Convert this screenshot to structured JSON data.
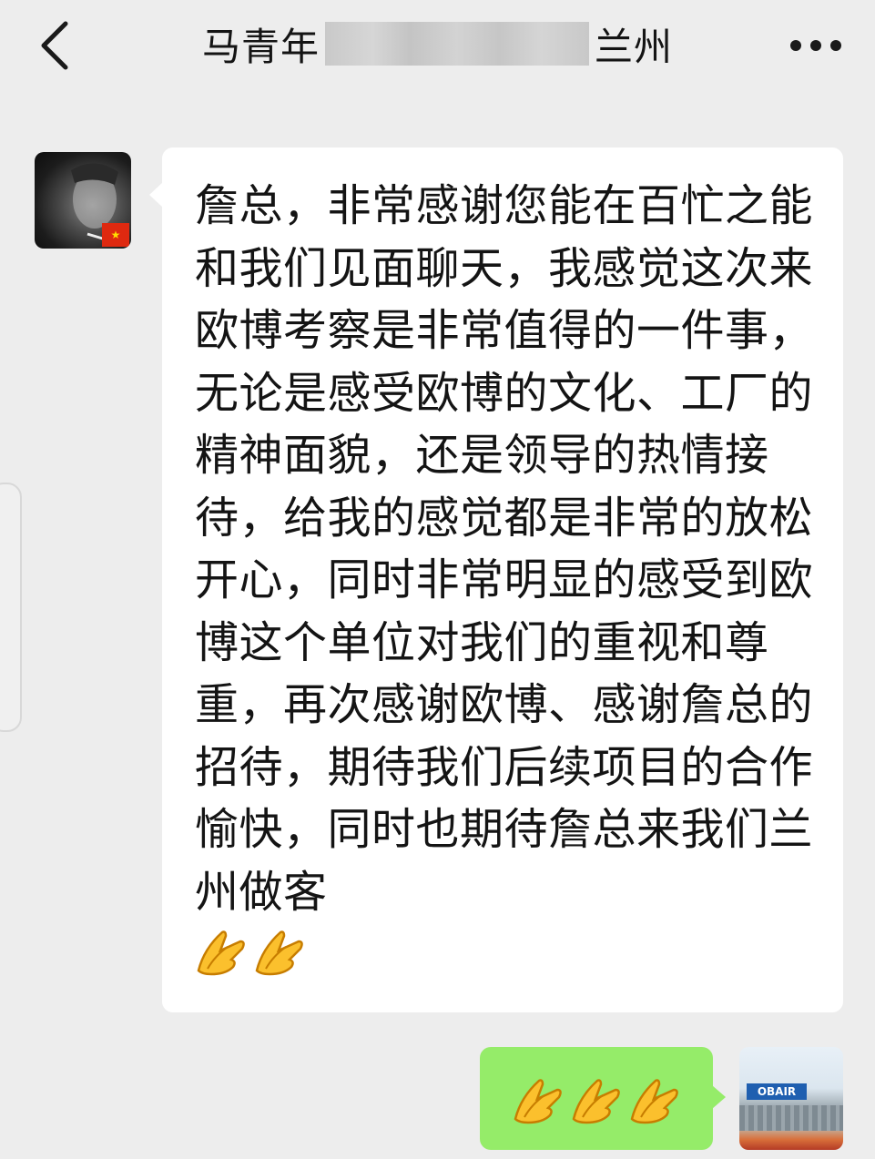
{
  "header": {
    "contact_name_left": "马青年",
    "contact_name_right": "兰州",
    "back_icon": "chevron-left-icon",
    "more_icon": "more-dots-icon"
  },
  "messages": [
    {
      "direction": "incoming",
      "avatar": "contact-avatar",
      "text": "詹总，非常感谢您能在百忙之能和我们见面聊天，我感觉这次来欧博考察是非常值得的一件事，无论是感受欧博的文化、工厂的精神面貌，还是领导的热情接待，给我的感觉都是非常的放松开心，同时非常明显的感受到欧博这个单位对我们的重视和尊重，再次感谢欧博、感谢詹总的招待，期待我们后续项目的合作愉快，同时也期待詹总来我们兰州做客",
      "emojis": [
        "palms-together-icon",
        "palms-together-icon"
      ]
    },
    {
      "direction": "outgoing",
      "avatar": "self-avatar",
      "emojis": [
        "palms-together-icon",
        "palms-together-icon",
        "palms-together-icon"
      ]
    }
  ],
  "colors": {
    "background": "#ededed",
    "incoming_bubble": "#ffffff",
    "outgoing_bubble": "#95ec69",
    "text": "#141414"
  }
}
